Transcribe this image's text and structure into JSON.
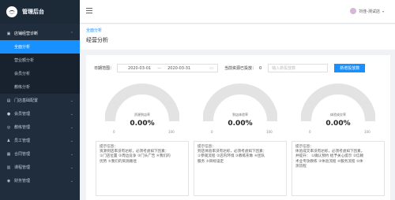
{
  "app": {
    "title": "管理后台"
  },
  "sidebar": {
    "menus": [
      {
        "label": "店铺经营诊断",
        "icon": "store-icon",
        "open": true,
        "children": [
          {
            "label": "全面分析",
            "active": true
          },
          {
            "label": "营业额分析",
            "active": false
          },
          {
            "label": "会员分析",
            "active": false
          },
          {
            "label": "教练分析",
            "active": false
          }
        ]
      },
      {
        "label": "门店基础配置",
        "icon": "doc-icon"
      },
      {
        "label": "会员管理",
        "icon": "user-icon"
      },
      {
        "label": "教练管理",
        "icon": "coach-icon"
      },
      {
        "label": "员工管理",
        "icon": "staff-icon"
      },
      {
        "label": "合同管理",
        "icon": "contract-icon"
      },
      {
        "label": "课程管理",
        "icon": "course-icon"
      },
      {
        "label": "财务管理",
        "icon": "finance-icon"
      }
    ]
  },
  "header": {
    "user_name": "刘佳-测试店"
  },
  "breadcrumb": {
    "text": "全面分析"
  },
  "page": {
    "title": "经营分析"
  },
  "filter": {
    "date_label": "日期范围：",
    "start_date": "2020-03-01",
    "end_date": "2020-03-31",
    "date_separator": "—",
    "resource_label": "当前资源已投放：",
    "resource_value": "0",
    "input_placeholder": "输入新投放数",
    "submit_label": "新增投放数"
  },
  "gauges": [
    {
      "name": "资源到店率",
      "value": "0.00%",
      "min": "0",
      "max": "100",
      "fraction": 0,
      "tip_title": "提示信息：",
      "tip_lines": [
        "资源到店率没有达标，必须考虑如下因素：",
        "①门店位置 ②周边竞争 ③门头广告 ④我们的",
        "优势 ⑤我们的资源路径"
      ]
    },
    {
      "name": "到店体验率",
      "value": "0.00%",
      "min": "0",
      "max": "100",
      "fraction": 0,
      "tip_title": "提示信息：",
      "tip_lines": [
        "到店体验率没有达标，必须考虑如下因素：",
        "①参观流程 ②店内环境 ③教练形象 ④团队",
        "服务 ⑤目标设定"
      ]
    },
    {
      "name": "体验成交率",
      "value": "0.00%",
      "min": "0",
      "max": "100",
      "fraction": 0,
      "tip_title": "提示信息：",
      "tip_lines": [
        "体验成交率没有达标，必须考虑如下因素，",
        "并提升： ①确认预约 给予关心提示 ②信赖",
        "术业专攻教练 ③体验流程 ④服务流程 ⑤体",
        "测流程"
      ]
    }
  ],
  "colors": {
    "accent": "#1890ff",
    "sidebar_bg": "#1f2d3d",
    "gauge_track": "#e3e3e3"
  }
}
